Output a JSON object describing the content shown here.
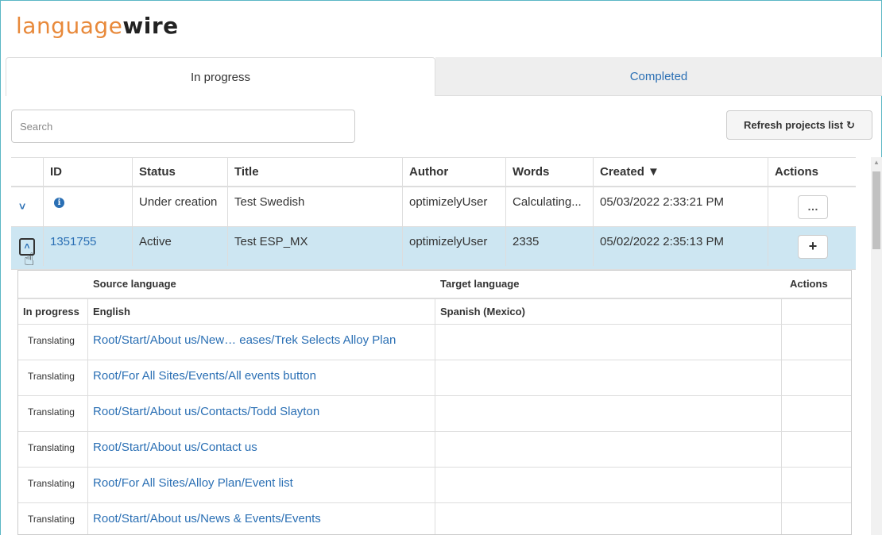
{
  "brand": {
    "part1": "language",
    "part2": "wire"
  },
  "tabs": [
    {
      "label": "In progress",
      "active": true
    },
    {
      "label": "Completed",
      "active": false
    }
  ],
  "search": {
    "placeholder": "Search",
    "value": ""
  },
  "refresh_label": "Refresh projects list",
  "refresh_icon": "refresh-icon",
  "table": {
    "columns": [
      "ID",
      "Status",
      "Title",
      "Author",
      "Words",
      "Created ▼",
      "Actions"
    ],
    "rows": [
      {
        "id": "",
        "status": "Under creation",
        "title": "Test Swedish",
        "author": "optimizelyUser",
        "words": "Calculating...",
        "created": "05/03/2022 2:33:21 PM",
        "action": "…"
      },
      {
        "id": "1351755",
        "status": "Active",
        "title": "Test ESP_MX",
        "author": "optimizelyUser",
        "words": "2335",
        "created": "05/02/2022 2:35:13 PM",
        "action": "+"
      }
    ]
  },
  "subtable": {
    "headers": {
      "source": "Source language",
      "target": "Target language",
      "actions": "Actions"
    },
    "lang_row": {
      "state": "In progress",
      "source": "English",
      "target": "Spanish (Mexico)"
    },
    "items": [
      {
        "state": "Translating",
        "path": "Root/Start/About us/New… eases/Trek Selects Alloy Plan"
      },
      {
        "state": "Translating",
        "path": "Root/For All Sites/Events/All events button"
      },
      {
        "state": "Translating",
        "path": "Root/Start/About us/Contacts/Todd Slayton"
      },
      {
        "state": "Translating",
        "path": "Root/Start/About us/Contact us"
      },
      {
        "state": "Translating",
        "path": "Root/For All Sites/Alloy Plan/Event list"
      },
      {
        "state": "Translating",
        "path": "Root/Start/About us/News & Events/Events"
      }
    ]
  }
}
